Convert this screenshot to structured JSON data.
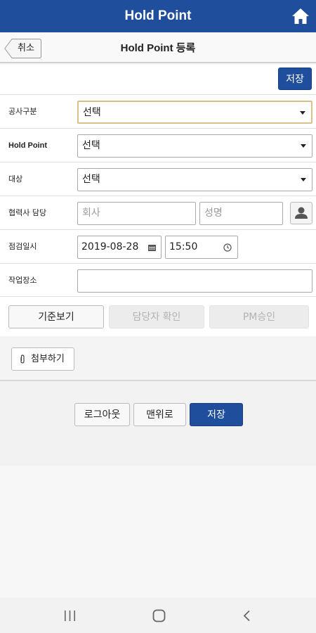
{
  "header": {
    "title": "Hold Point",
    "home_icon": "home-icon"
  },
  "subheader": {
    "back_label": "취소",
    "title": "Hold Point 등록"
  },
  "toolbar": {
    "save_label": "저장"
  },
  "form": {
    "construction_type": {
      "label": "공사구분",
      "value": "선택"
    },
    "hold_point": {
      "label": "Hold Point",
      "value": "선택"
    },
    "target": {
      "label": "대상",
      "value": "선택"
    },
    "partner_manager": {
      "label": "협력사 담당",
      "company_placeholder": "회사",
      "name_placeholder": "성명",
      "icon": "person-icon"
    },
    "inspection_datetime": {
      "label": "점검일시",
      "date": "2019-08-28",
      "time": "15:50"
    },
    "work_location": {
      "label": "작업장소",
      "value": ""
    }
  },
  "actions": {
    "view_standard": "기준보기",
    "confirm_manager": "담당자 확인",
    "pm_approve": "PM승인"
  },
  "attach": {
    "label": "첨부하기"
  },
  "footer": {
    "logout": "로그아웃",
    "to_top": "맨위로",
    "save": "저장"
  },
  "colors": {
    "primary": "#1f4e9c",
    "focus_border": "#d9c28a"
  }
}
